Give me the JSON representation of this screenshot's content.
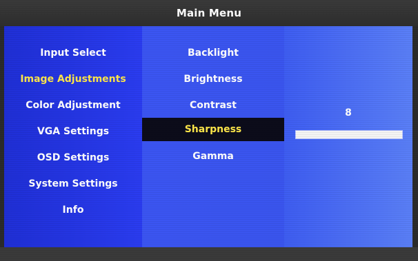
{
  "title": "Main Menu",
  "main_menu": {
    "items": [
      {
        "label": "Input Select"
      },
      {
        "label": "Image Adjustments"
      },
      {
        "label": "Color Adjustment"
      },
      {
        "label": "VGA Settings"
      },
      {
        "label": "OSD Settings"
      },
      {
        "label": "System Settings"
      },
      {
        "label": "Info"
      }
    ],
    "active": "Image Adjustments"
  },
  "sub_menu": {
    "items": [
      {
        "label": "Backlight"
      },
      {
        "label": "Brightness"
      },
      {
        "label": "Contrast"
      },
      {
        "label": "Sharpness"
      },
      {
        "label": "Gamma"
      }
    ],
    "selected": "Sharpness"
  },
  "value_panel": {
    "value": "8",
    "slider_fill_fraction": 1.0
  },
  "colors": {
    "active_text": "#ffe84a",
    "selected_bg": "#0c0c1a",
    "panel_left": "#2a3cf0",
    "panel_mid": "#3a55ef",
    "panel_right": "#5a7ff7"
  }
}
